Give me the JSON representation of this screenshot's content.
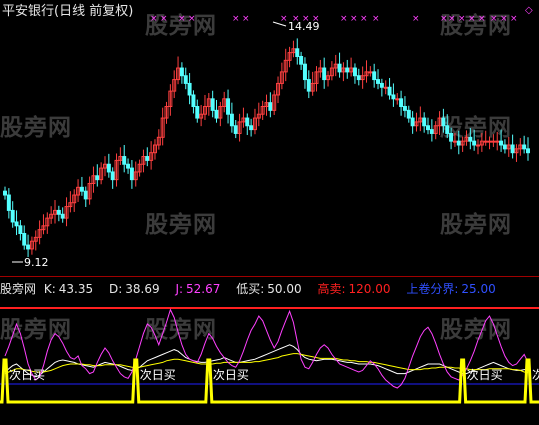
{
  "header": {
    "title": "平安银行(日线 前复权)"
  },
  "watermark": {
    "text": "股旁网"
  },
  "price_panel": {
    "high_label": "14.49",
    "low_label": "9.12",
    "colors": {
      "up": "#ff4040",
      "down": "#54ffff",
      "marker": "#ff40ff"
    }
  },
  "indicator_panel": {
    "name": "股旁网",
    "k_label": "K:",
    "k_value": "43.35",
    "d_label": "D:",
    "d_value": "38.69",
    "j_label": "J:",
    "j_value": "52.67",
    "low_buy_label": "低买:",
    "low_buy_value": "50.00",
    "high_sell_label": "高卖:",
    "high_sell_value": "120.00",
    "boundary_label": "上卷分界:",
    "boundary_value": "25.00",
    "signal_label": "次日买",
    "colors": {
      "k": "#ffffff",
      "d": "#ffff00",
      "j": "#ff40ff",
      "low_buy": "#ffffff",
      "high_sell": "#ff2020",
      "boundary": "#2020ff",
      "signal": "#ffff00"
    }
  },
  "chart_data": [
    {
      "type": "candlestick",
      "title": "平安银行(日线 前复权)",
      "annotations": [
        {
          "text": "14.49",
          "value": 14.49
        },
        {
          "text": "9.12",
          "value": 9.12
        }
      ],
      "ylim": [
        8.6,
        15.2
      ],
      "series": [
        {
          "name": "close",
          "values": [
            10.6,
            10.2,
            9.9,
            9.8,
            9.6,
            9.3,
            9.2,
            9.4,
            9.5,
            9.7,
            9.8,
            10.0,
            10.1,
            10.2,
            10.1,
            10.0,
            10.3,
            10.4,
            10.6,
            10.8,
            10.7,
            10.5,
            10.9,
            11.1,
            11.0,
            11.3,
            11.4,
            11.2,
            11.0,
            11.5,
            11.6,
            11.4,
            11.3,
            11.0,
            11.2,
            11.4,
            11.6,
            11.5,
            11.7,
            11.9,
            12.1,
            12.6,
            12.9,
            13.3,
            13.6,
            13.9,
            13.7,
            13.5,
            13.2,
            12.9,
            12.6,
            12.7,
            12.9,
            13.1,
            12.8,
            12.6,
            12.9,
            13.1,
            12.7,
            12.4,
            12.2,
            12.5,
            12.6,
            12.4,
            12.3,
            12.6,
            12.7,
            12.9,
            13.0,
            12.8,
            13.2,
            13.5,
            13.8,
            14.1,
            14.3,
            14.4,
            14.2,
            14.0,
            13.6,
            13.3,
            13.5,
            13.8,
            13.9,
            13.6,
            13.7,
            13.9,
            14.0,
            13.8,
            13.9,
            13.8,
            13.9,
            13.7,
            13.6,
            13.7,
            13.8,
            13.8,
            13.6,
            13.5,
            13.4,
            13.4,
            13.2,
            13.1,
            13.1,
            12.9,
            12.8,
            12.6,
            12.4,
            12.5,
            12.6,
            12.4,
            12.3,
            12.2,
            12.4,
            12.6,
            12.4,
            12.2,
            12.0,
            12.0,
            11.9,
            12.0,
            12.1,
            12.0,
            11.9,
            11.9,
            12.0,
            12.0,
            12.0,
            12.0,
            12.0,
            11.9,
            11.8,
            11.9,
            11.7,
            11.8,
            11.9,
            11.8,
            11.7
          ]
        }
      ]
    },
    {
      "type": "line",
      "ylim": [
        -20,
        140
      ],
      "series": [
        {
          "name": "K",
          "values": [
            40,
            44,
            48,
            50,
            46,
            42,
            38,
            36,
            34,
            36,
            40,
            44,
            48,
            52,
            54,
            55,
            54,
            53,
            52,
            50,
            49,
            48,
            47,
            46,
            48,
            50,
            52,
            51,
            50,
            49,
            47,
            45,
            43,
            42,
            44,
            46,
            50,
            54,
            56,
            58,
            60,
            62,
            64,
            66,
            68,
            66,
            62,
            58,
            56,
            54,
            53,
            52,
            52,
            53,
            54,
            55,
            56,
            58,
            56,
            54,
            52,
            52,
            53,
            54,
            55,
            56,
            58,
            60,
            62,
            64,
            66,
            68,
            70,
            72,
            74,
            72,
            68,
            62,
            58,
            56,
            55,
            54,
            55,
            56,
            56,
            56,
            55,
            54,
            53,
            52,
            52,
            51,
            50,
            50,
            50,
            50,
            49,
            48,
            46,
            44,
            42,
            40,
            38,
            38,
            38,
            40,
            42,
            44,
            46,
            48,
            50,
            50,
            50,
            50,
            48,
            46,
            44,
            42,
            40,
            38,
            38,
            40,
            42,
            44,
            46,
            48,
            50,
            52,
            50,
            48,
            46,
            44,
            43,
            42,
            42,
            43,
            43
          ]
        },
        {
          "name": "D",
          "values": [
            38,
            40,
            42,
            44,
            44,
            43,
            42,
            41,
            40,
            40,
            40,
            41,
            42,
            44,
            46,
            48,
            49,
            50,
            50,
            50,
            50,
            49,
            49,
            48,
            48,
            48,
            49,
            49,
            49,
            49,
            49,
            48,
            47,
            46,
            46,
            46,
            47,
            48,
            49,
            50,
            51,
            52,
            54,
            55,
            56,
            56,
            55,
            54,
            53,
            52,
            51,
            50,
            50,
            50,
            50,
            51,
            51,
            52,
            52,
            52,
            52,
            52,
            52,
            52,
            52,
            53,
            53,
            54,
            55,
            56,
            57,
            58,
            60,
            61,
            62,
            63,
            63,
            62,
            61,
            60,
            59,
            58,
            57,
            57,
            57,
            57,
            57,
            56,
            55,
            55,
            54,
            54,
            53,
            53,
            53,
            52,
            52,
            51,
            50,
            49,
            48,
            47,
            46,
            45,
            44,
            43,
            43,
            43,
            43,
            44,
            44,
            45,
            45,
            46,
            46,
            46,
            46,
            45,
            45,
            44,
            44,
            43,
            43,
            43,
            43,
            43,
            44,
            44,
            44,
            44,
            44,
            44,
            43,
            43,
            42,
            40,
            39
          ]
        },
        {
          "name": "J",
          "values": [
            60,
            72,
            86,
            100,
            88,
            70,
            50,
            38,
            30,
            34,
            48,
            66,
            80,
            88,
            84,
            76,
            66,
            58,
            56,
            60,
            48,
            44,
            38,
            40,
            52,
            62,
            70,
            64,
            54,
            46,
            38,
            34,
            32,
            40,
            56,
            72,
            88,
            100,
            96,
            86,
            74,
            88,
            102,
            118,
            108,
            90,
            74,
            62,
            56,
            54,
            52,
            62,
            76,
            88,
            82,
            72,
            64,
            58,
            52,
            48,
            46,
            54,
            66,
            80,
            92,
            100,
            110,
            104,
            92,
            80,
            70,
            78,
            92,
            104,
            116,
            102,
            78,
            56,
            46,
            44,
            52,
            62,
            70,
            74,
            70,
            62,
            56,
            50,
            48,
            46,
            44,
            42,
            40,
            42,
            48,
            54,
            50,
            44,
            36,
            30,
            26,
            22,
            20,
            24,
            32,
            46,
            60,
            72,
            84,
            92,
            96,
            88,
            76,
            62,
            50,
            40,
            34,
            32,
            30,
            36,
            44,
            54,
            66,
            80,
            92,
            104,
            110,
            100,
            86,
            72,
            60,
            52,
            48,
            50,
            56,
            62,
            52
          ]
        }
      ],
      "reference_lines": [
        {
          "name": "低买",
          "value": 50
        },
        {
          "name": "高卖",
          "value": 120
        },
        {
          "name": "上卷分界",
          "value": 25
        }
      ],
      "signal_series": {
        "name": "次日买",
        "x": [
          0,
          34,
          53,
          119,
          136
        ]
      }
    }
  ]
}
